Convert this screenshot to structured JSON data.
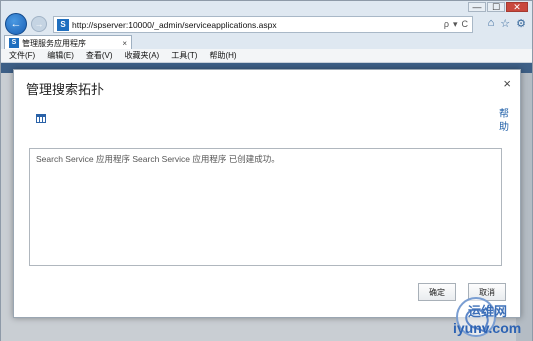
{
  "browser": {
    "url": "http://spserver:10000/_admin/serviceapplications.aspx",
    "site_icon": "S",
    "addr_tools": [
      "ρ",
      "▾",
      "C"
    ],
    "tab_label": "管理服务应用程序",
    "tab_close": "×",
    "toolbar_icons": [
      "home-icon",
      "star-icon",
      "gear-icon"
    ],
    "window_buttons": [
      "—",
      "☐",
      "✕"
    ]
  },
  "menubar": {
    "items": [
      "文件(F)",
      "编辑(E)",
      "查看(V)",
      "收藏夹(A)",
      "工具(T)",
      "帮助(H)"
    ]
  },
  "dialog": {
    "title": "管理搜索拓扑",
    "close": "×",
    "help": "帮助",
    "status_message": "Search Service 应用程序 Search Service 应用程序 已创建成功。",
    "ok_label": "确定",
    "cancel_label": "取消"
  },
  "watermark": {
    "top": "运维网",
    "bottom": "iyunv.com"
  },
  "colors": {
    "accent_blue": "#1f5fa8",
    "browser_chrome": "#dfe8f1",
    "page_header_bar": "#3d5f86"
  }
}
